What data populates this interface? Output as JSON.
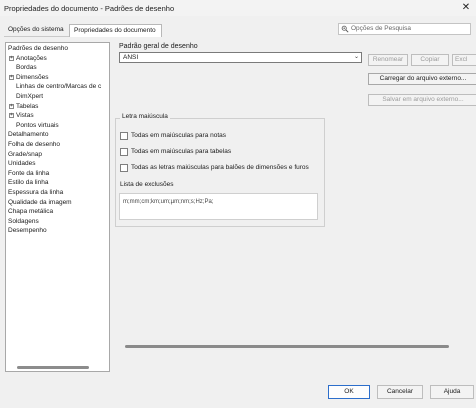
{
  "window": {
    "title": "Propriedades do documento - Padrões de desenho",
    "close_glyph": "✕"
  },
  "tabs": [
    {
      "label": "Opções do sistema"
    },
    {
      "label": "Propriedades do documento"
    }
  ],
  "search": {
    "placeholder": "Opções de Pesquisa",
    "icon": "gear-search-icon"
  },
  "tree": {
    "items": [
      {
        "label": "Padrões de desenho",
        "level": 0,
        "expander": ""
      },
      {
        "label": "Anotações",
        "level": 1,
        "expander": "+"
      },
      {
        "label": "Bordas",
        "level": 2,
        "expander": ""
      },
      {
        "label": "Dimensões",
        "level": 1,
        "expander": "+"
      },
      {
        "label": "Linhas de centro/Marcas de c",
        "level": 2,
        "expander": ""
      },
      {
        "label": "DimXpert",
        "level": 2,
        "expander": ""
      },
      {
        "label": "Tabelas",
        "level": 1,
        "expander": "+"
      },
      {
        "label": "Vistas",
        "level": 1,
        "expander": "+"
      },
      {
        "label": "Pontos virtuais",
        "level": 2,
        "expander": ""
      },
      {
        "label": "Detalhamento",
        "level": 0,
        "expander": ""
      },
      {
        "label": "Folha de desenho",
        "level": 0,
        "expander": ""
      },
      {
        "label": "Grade/snap",
        "level": 0,
        "expander": ""
      },
      {
        "label": "Unidades",
        "level": 0,
        "expander": ""
      },
      {
        "label": "Fonte da linha",
        "level": 0,
        "expander": ""
      },
      {
        "label": "Estilo da linha",
        "level": 0,
        "expander": ""
      },
      {
        "label": "Espessura da linha",
        "level": 0,
        "expander": ""
      },
      {
        "label": "Qualidade da imagem",
        "level": 0,
        "expander": ""
      },
      {
        "label": "Chapa metálica",
        "level": 0,
        "expander": ""
      },
      {
        "label": "Soldagens",
        "level": 0,
        "expander": ""
      },
      {
        "label": "Desempenho",
        "level": 0,
        "expander": ""
      }
    ]
  },
  "content": {
    "general_standard_label": "Padrão geral de desenho",
    "general_standard_value": "ANSI",
    "buttons": {
      "rename": "Renomear",
      "copy": "Copiar",
      "delete": "Excl",
      "load": "Carregar do arquivo externo...",
      "save": "Salvar em arquivo externo..."
    },
    "uppercase": {
      "legend": "Letra maiúscula",
      "options": [
        {
          "label": "Todas em maiúsculas para notas",
          "checked": false
        },
        {
          "label": "Todas em maiúsculas para tabelas",
          "checked": false
        },
        {
          "label": "Todas as letras maiúsculas para balões de dimensões e furos",
          "checked": false
        }
      ],
      "exclusion_label": "Lista de exclusões",
      "exclusion_value": "m;mm;cm;km;um;µm;nm;s;Hz;Pa;"
    }
  },
  "footer": {
    "ok": "OK",
    "cancel": "Cancelar",
    "help": "Ajuda"
  }
}
